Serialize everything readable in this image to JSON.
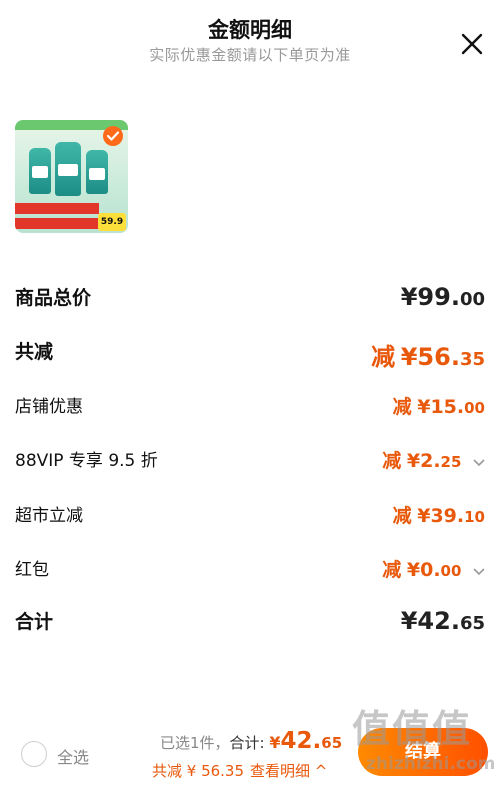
{
  "header": {
    "title": "金额明细",
    "subtitle": "实际优惠金额请以下单页为准",
    "close_icon": "close-icon"
  },
  "product": {
    "thumbnail_icon": "laundry-detergent-product-image",
    "selected_icon": "check-circle-icon",
    "image_price": "59.9"
  },
  "breakdown": {
    "total_price": {
      "label": "商品总价",
      "currency": "¥",
      "int": "99.",
      "dec": "00"
    },
    "total_discount": {
      "label": "共减",
      "prefix": "减",
      "currency": "¥",
      "int": "56.",
      "dec": "35"
    },
    "store_discount": {
      "label": "店铺优惠",
      "prefix": "减",
      "currency": "¥",
      "int": "15.",
      "dec": "00"
    },
    "vip_discount": {
      "label": "88VIP 专享 9.5 折",
      "prefix": "减",
      "currency": "¥",
      "int": "2.",
      "dec": "25",
      "expandable": true
    },
    "market_discount": {
      "label": "超市立减",
      "prefix": "减",
      "currency": "¥",
      "int": "39.",
      "dec": "10"
    },
    "red_packet": {
      "label": "红包",
      "prefix": "减",
      "currency": "¥",
      "int": "0.",
      "dec": "00",
      "expandable": true
    },
    "subtotal": {
      "label": "合计",
      "currency": "¥",
      "int": "42.",
      "dec": "65"
    }
  },
  "bottom_bar": {
    "select_all": "全选",
    "selected_count": "已选1件，",
    "total_label": "合计:",
    "total_currency": "¥",
    "total_int": "42.",
    "total_dec": "65",
    "saving_text": "共减 ¥ 56.35",
    "detail_link": "查看明细 ^",
    "checkout_label": "结算"
  },
  "watermark": {
    "chars": "值值值",
    "url": "zhizhizhi.com"
  },
  "colors": {
    "accent": "#e8590c",
    "checkout_start": "#ff8a00",
    "checkout_end": "#ff5000"
  }
}
